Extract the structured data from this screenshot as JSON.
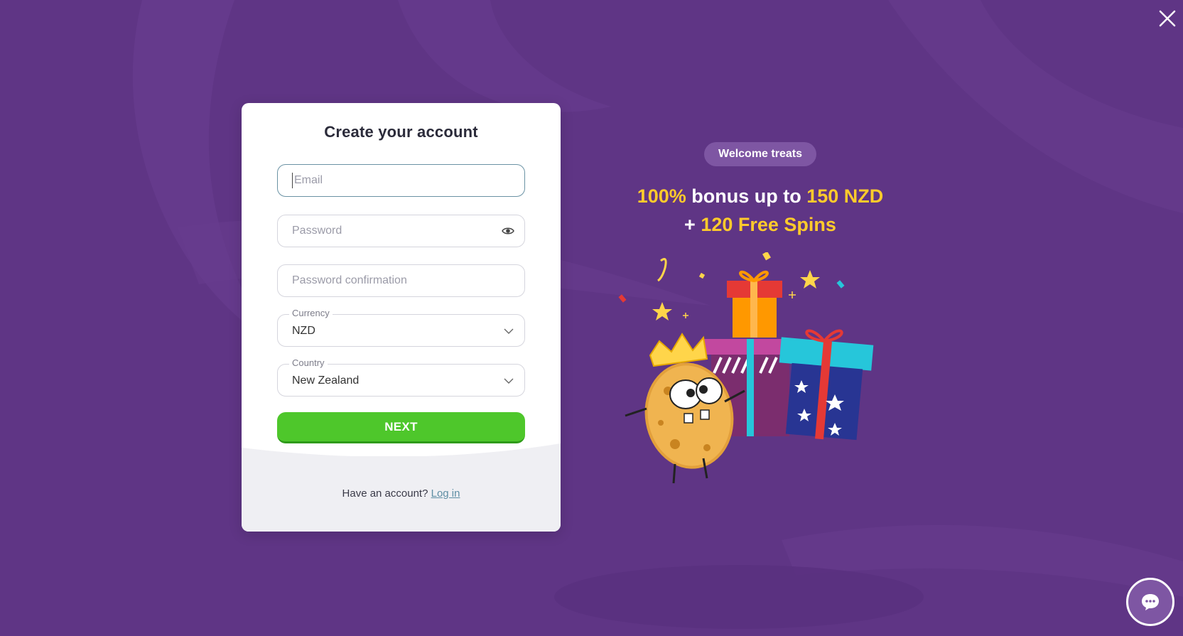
{
  "modal": {
    "title": "Create your account",
    "email": {
      "placeholder": "Email"
    },
    "password": {
      "placeholder": "Password"
    },
    "password_confirmation": {
      "placeholder": "Password confirmation"
    },
    "currency": {
      "label": "Currency",
      "value": "NZD"
    },
    "country": {
      "label": "Country",
      "value": "New Zealand"
    },
    "next_label": "NEXT",
    "footer": {
      "question": "Have an account?",
      "login_link": "Log in"
    }
  },
  "promo": {
    "pill": "Welcome treats",
    "line1_part1": "100%",
    "line1_part2": " bonus up to ",
    "line1_part3": "150 NZD",
    "line2_part1": "+ ",
    "line2_part2": "120 Free Spins"
  },
  "icons": {
    "close": "close-icon",
    "eye": "eye-icon",
    "chevron": "chevron-down-icon",
    "chat": "chat-icon"
  },
  "colors": {
    "background": "#5f3585",
    "accent_green": "#4ec72b",
    "promo_yellow": "#ffcb2b",
    "link": "#5e8ea4"
  }
}
